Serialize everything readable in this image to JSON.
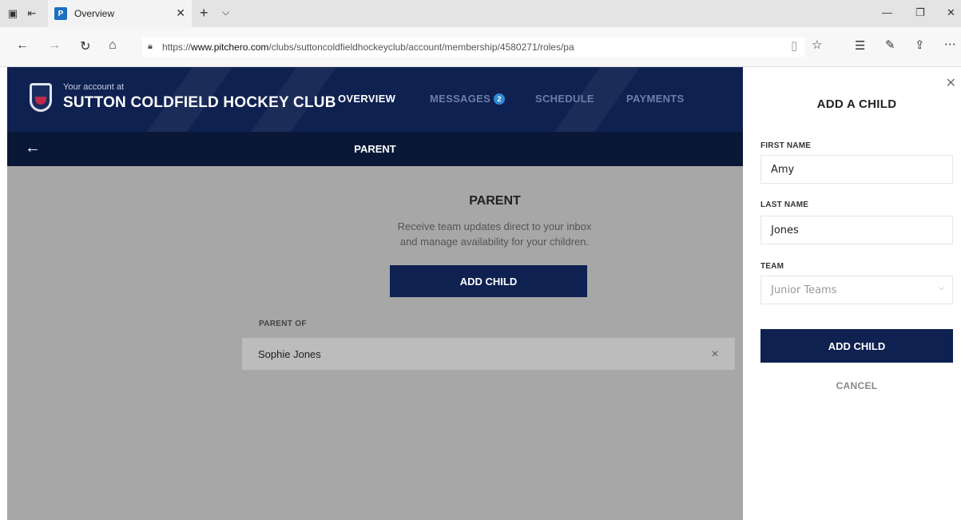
{
  "browser": {
    "tab_title": "Overview",
    "favicon": "pitchero-icon",
    "url_prefix": "https://",
    "url_domain": "www.pitchero.com",
    "url_path": "/clubs/suttoncoldfieldhockeyclub/account/membership/4580271/roles/pa"
  },
  "header": {
    "account_prefix": "Your account at",
    "club_name": "SUTTON COLDFIELD HOCKEY CLUB",
    "nav": {
      "overview": "OVERVIEW",
      "messages": "MESSAGES",
      "messages_count": "2",
      "schedule": "SCHEDULE",
      "payments": "PAYMENTS"
    }
  },
  "subbar": {
    "title": "PARENT"
  },
  "main": {
    "role_title": "PARENT",
    "role_desc_line1": "Receive team updates direct to your inbox",
    "role_desc_line2": "and manage availability for your children.",
    "add_child_label": "ADD CHILD",
    "parent_of_label": "PARENT OF",
    "children": [
      {
        "name": "Sophie Jones"
      }
    ]
  },
  "panel": {
    "title": "ADD A CHILD",
    "first_name_label": "FIRST NAME",
    "first_name_value": "Amy",
    "last_name_label": "LAST NAME",
    "last_name_value": "Jones",
    "team_label": "TEAM",
    "team_value": "Junior Teams",
    "submit_label": "ADD CHILD",
    "cancel_label": "CANCEL"
  },
  "colors": {
    "brand_navy": "#0f2151",
    "overlay_gray": "#a7a7a7",
    "badge_blue": "#2f8bd3"
  }
}
